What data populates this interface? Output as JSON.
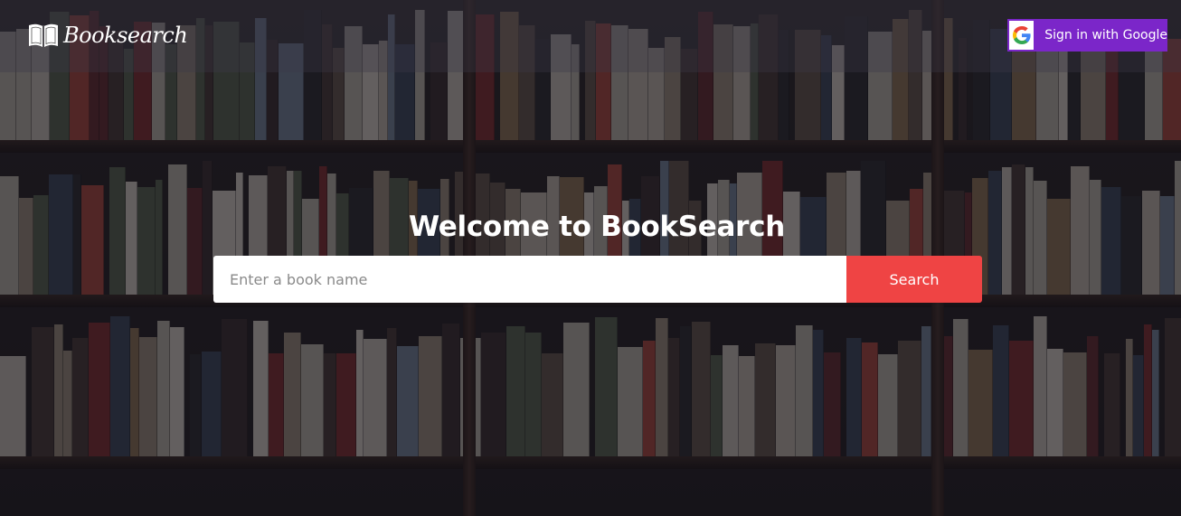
{
  "header": {
    "logo_text": "Booksearch",
    "logo_icon": "open-book-icon",
    "google_button_label": "Sign in with Google",
    "google_icon": "google-g-icon"
  },
  "hero": {
    "title": "Welcome to BookSearch",
    "search_placeholder": "Enter a book name",
    "search_value": "",
    "search_button_label": "Search"
  },
  "colors": {
    "google_button": "#7b26c9",
    "search_button": "#ef4444",
    "header_bar": "rgba(60,58,72,0.35)"
  }
}
